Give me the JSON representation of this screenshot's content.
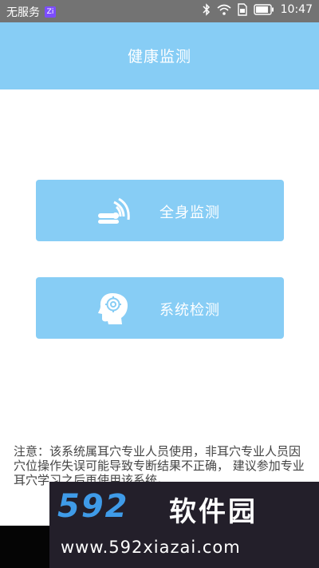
{
  "status_bar": {
    "carrier": "无服务",
    "carrier_badge": "Zi",
    "time": "10:47"
  },
  "header": {
    "title": "健康监测"
  },
  "actions": [
    {
      "label": "全身监测",
      "icon": "body-scan-icon"
    },
    {
      "label": "系统检测",
      "icon": "head-gear-icon"
    }
  ],
  "notice": {
    "text": "注意：该系统属耳穴专业人员使用，非耳穴专业人员因穴位操作失误可能导致专断结果不正确，      建议参加专业耳穴学习之后再使用该系统。"
  },
  "watermark": {
    "logo": "592",
    "brand": "软件园",
    "url": "www.592xiazai.com"
  },
  "colors": {
    "accent": "#87cdf5",
    "status_bar": "#737373",
    "watermark_bg": "#231f2a",
    "watermark_logo": "#3f9be8"
  }
}
